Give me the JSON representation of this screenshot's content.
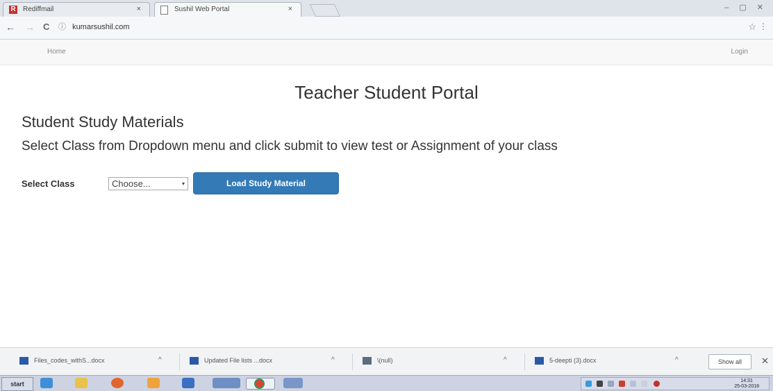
{
  "browser": {
    "tabs": [
      {
        "title": "Rediffmail",
        "close": "×"
      },
      {
        "title": "Sushil Web Portal",
        "close": "×"
      }
    ],
    "favicon_rediff": "R",
    "window_controls": "– ▢ ✕",
    "nav": {
      "back": "←",
      "forward": "→",
      "reload": "C"
    },
    "address_info": "ⓘ",
    "url": "kumarsushil.com",
    "star": "☆",
    "menu": "⋮"
  },
  "page": {
    "nav": {
      "home": "Home",
      "login": "Login"
    },
    "title": "Teacher Student Portal",
    "section_heading": "Student Study Materials",
    "instructions": "Select Class from Dropdown menu and click submit to view test or Assignment of your class",
    "form": {
      "select_label": "Select Class",
      "select_value": "Choose...",
      "select_caret": "▾",
      "submit_label": "Load Study Material"
    },
    "colors": {
      "primary_button": "#337ab7",
      "navbar_bg": "#f8f8f8"
    }
  },
  "downloads": {
    "items": [
      {
        "name": "Files_codes_withS...docx",
        "caret": "^",
        "icon": "word-doc-icon"
      },
      {
        "name": "Updated File lists ...docx",
        "caret": "^",
        "icon": "word-doc-icon"
      },
      {
        "name": "\\(null)",
        "caret": "^",
        "icon": "image-file-icon"
      },
      {
        "name": "5-deepti (3).docx",
        "caret": "^",
        "icon": "word-doc-icon"
      }
    ],
    "show_all": "Show all",
    "close": "✕"
  },
  "taskbar": {
    "start_label": "start",
    "clock_time": "14:31",
    "clock_date": "25-03-2018"
  }
}
